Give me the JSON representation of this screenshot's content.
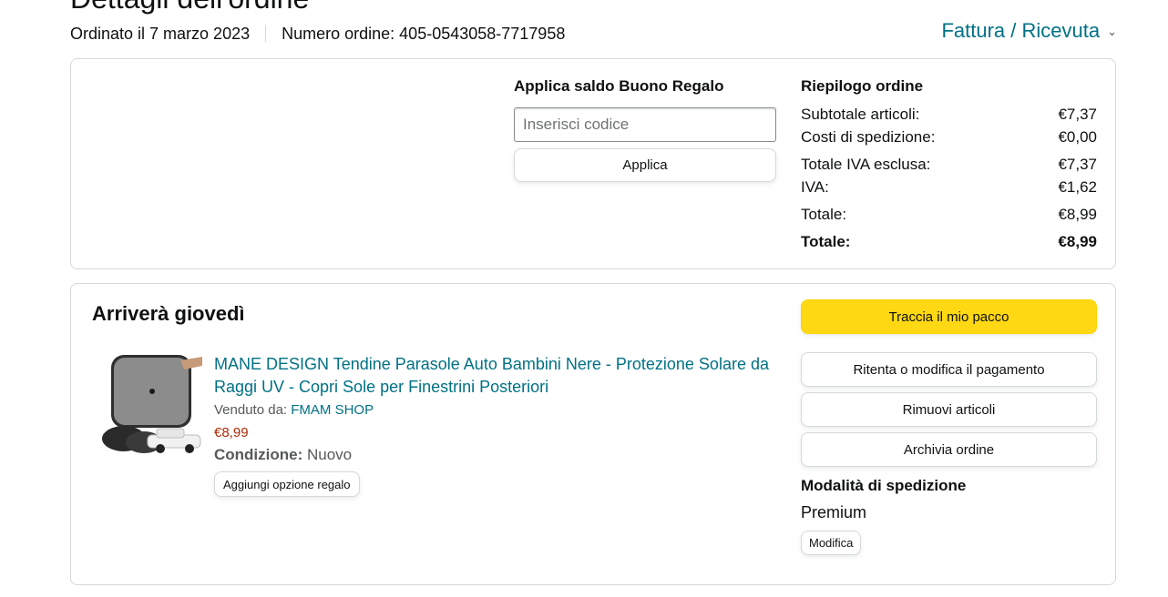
{
  "header": {
    "title": "Dettagli dell'ordine",
    "ordered_on": "Ordinato il 7 marzo 2023",
    "order_number": "Numero ordine: 405-0543058-7717958",
    "invoice_link": "Fattura / Ricevuta"
  },
  "gift_card": {
    "title": "Applica saldo Buono Regalo",
    "input_placeholder": "Inserisci codice",
    "input_value": "",
    "apply_label": "Applica"
  },
  "summary": {
    "title": "Riepilogo ordine",
    "rows": [
      {
        "label": "Subtotale articoli:",
        "value": "€7,37"
      },
      {
        "label": "Costi di spedizione:",
        "value": "€0,00"
      },
      {
        "label": "Totale IVA esclusa:",
        "value": "€7,37"
      },
      {
        "label": "IVA:",
        "value": "€1,62"
      },
      {
        "label": "Totale:",
        "value": "€8,99"
      },
      {
        "label": "Totale:",
        "value": "€8,99"
      }
    ]
  },
  "shipment": {
    "arrival": "Arriverà giovedì",
    "product": {
      "title": "MANE DESIGN Tendine Parasole Auto Bambini Nere - Protezione Solare da Raggi UV - Copri Sole per Finestrini Posteriori",
      "sold_by_label": "Venduto da:",
      "seller": "FMAM SHOP",
      "price": "€8,99",
      "condition_label": "Condizione:",
      "condition_value": "Nuovo",
      "gift_option_label": "Aggiungi opzione regalo"
    },
    "actions": {
      "track": "Traccia il mio pacco",
      "retry_payment": "Ritenta o modifica il pagamento",
      "remove_items": "Rimuovi articoli",
      "archive": "Archivia ordine"
    },
    "shipping_mode": {
      "title": "Modalità di spedizione",
      "value": "Premium",
      "modify_label": "Modifica"
    }
  },
  "colors": {
    "link": "#007185",
    "price": "#b12704",
    "track_button": "#ffd814",
    "border": "#d5d9d9"
  }
}
